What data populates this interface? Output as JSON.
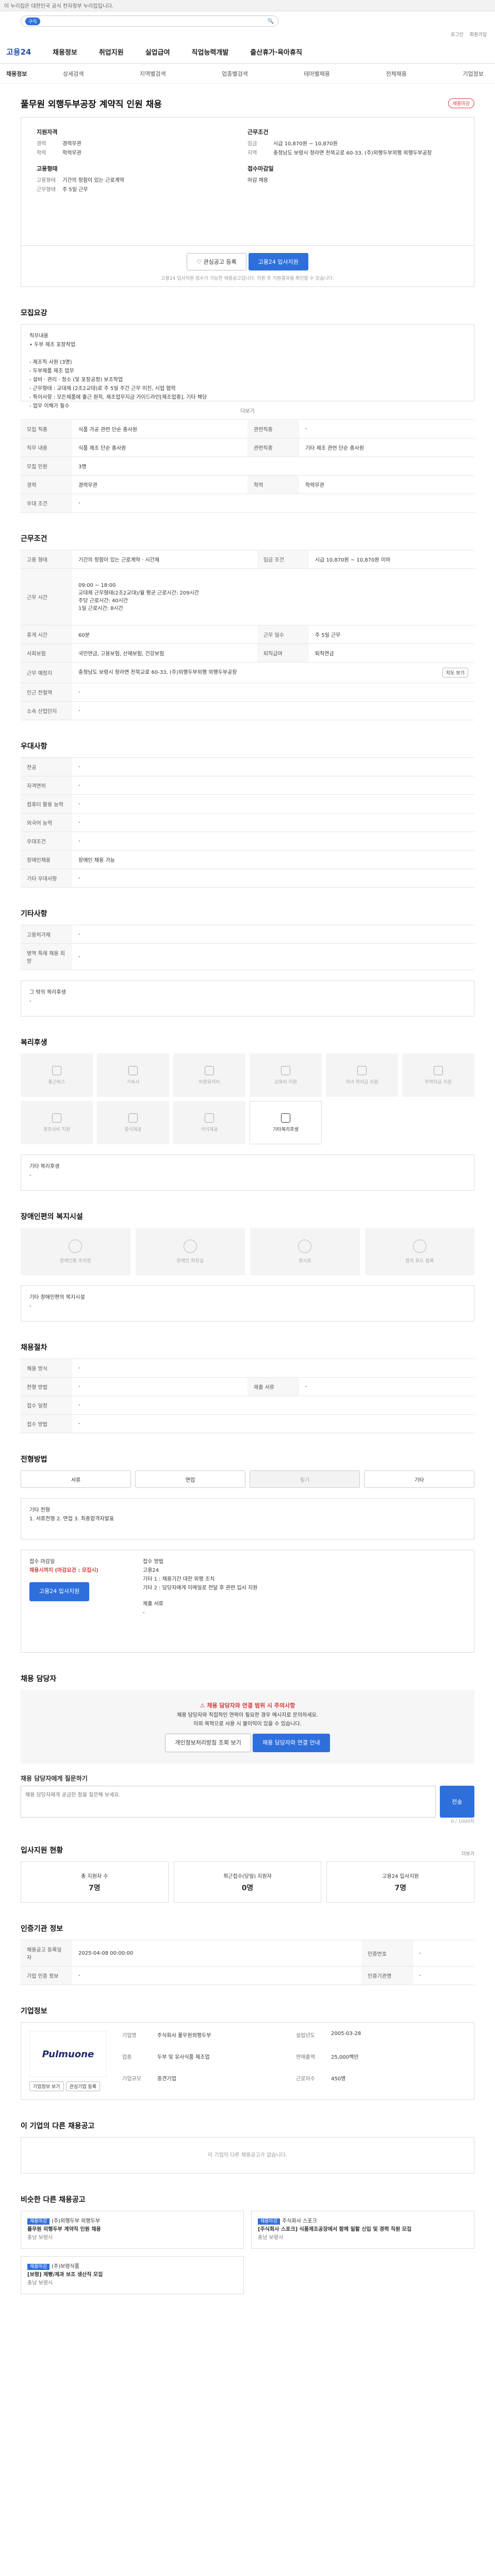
{
  "topbar": {
    "notice": "이 누리집은 대한민국 공식 전자정부 누리집입니다."
  },
  "search": {
    "tag": "구직",
    "placeholder": ""
  },
  "util": [
    "로그인",
    "회원가입"
  ],
  "gnb": {
    "logo": "고용24",
    "menu": [
      "채용정보",
      "취업지원",
      "실업급여",
      "직업능력개발",
      "출산휴가·육아휴직"
    ]
  },
  "subnav": {
    "current": "채용정보",
    "items": [
      "상세검색",
      "지역별검색",
      "업종별검색",
      "테마별채용",
      "전체채용",
      "기업정보"
    ]
  },
  "job": {
    "title": "풀무원 외행두부공장 계약직 인원 채용",
    "badge": "채용마감",
    "recruit_head": "지원자격",
    "recruit": [
      {
        "k": "경력",
        "v": "경력무관"
      },
      {
        "k": "학력",
        "v": "학력무관"
      }
    ],
    "cond_head": "근무조건",
    "cond": [
      {
        "k": "임금",
        "v": "시급 10,870원 ~ 10,870원"
      },
      {
        "k": "지역",
        "v": "충청남도 보령시 청라면 천북교로 60-33, (주)외행두부외행 외행두부공장"
      }
    ],
    "emp_head": "고용형태",
    "emp": [
      {
        "k": "고용형태",
        "v": "기간의 정함이 있는 근로계약"
      },
      {
        "k": "근무형태",
        "v": "주 5일 근무"
      }
    ],
    "deadline_head": "접수마감일",
    "deadline": "마감 채용",
    "btn_scrap": "관심공고 등록",
    "btn_apply": "고용24 입사지원",
    "apply_note": "고용24 입사지원 접수가 가능한 채용공고입니다. 지원 후 지원결과를 확인할 수 있습니다."
  },
  "sec1": {
    "title": "모집요강",
    "body": "직무내용\n• 두부 제조 포장작업\n\n- 제조직 사원 (3명)\n- 두부제품 제조 업무\n- 설비 · 관리 · 청소 (및 포장공정) 보조작업\n- 근무형태 : 교대제 (2조2교대)로 주 5일 주간 근무 미진, 시업 협력\n- 특이사항 : 모든제품에 출근 원칙, 제조업무지금 가이드라인[제조업종], 기타 해당\n- 업무 이해가 필수",
    "more": "더보기",
    "rows": [
      {
        "k": "모집 직종",
        "v": "식품 가공 관련 단순 종사원",
        "k2": "관련직종",
        "v2": "-"
      },
      {
        "k": "직무 내용",
        "v": "식품 제조 단순 종사원",
        "k2": "관련직종",
        "v2": "기타 제조 관련 단순 종사원"
      },
      {
        "k": "모집 인원",
        "v": "3명",
        "k2": "",
        "v2": ""
      },
      {
        "k": "경력",
        "v": "경력무관",
        "k2": "학력",
        "v2": "학력무관"
      },
      {
        "k": "우대 조건",
        "v": "-",
        "k2": "",
        "v2": ""
      }
    ]
  },
  "sec2": {
    "title": "근무조건",
    "rows": [
      {
        "k": "고용 형태",
        "v": "기간의 정함이 있는 근로계약 · 시간제",
        "k2": "임금 조건",
        "v2": "시급 10,870원 ~ 10,870원 이하"
      },
      {
        "k": "근무 시간",
        "v": "09:00 ~ 18:00\n교대제 근무형태(2조2교대)/월 평균 근로시간: 209시간\n주당 근로시간: 40시간\n1일 근로시간: 8시간",
        "k2": "",
        "v2": ""
      },
      {
        "k": "휴게 시간",
        "v": "60분",
        "k2": "근무 일수",
        "v2": "주 5일 근무"
      },
      {
        "k": "사회보험",
        "v": "국민연금, 고용보험, 산재보험, 건강보험",
        "k2": "퇴직급여",
        "v2": "퇴직연금"
      },
      {
        "k": "근무 예정지",
        "v": "충청남도 보령시 청라면 천북교로 60-33, (주)외행두부외행 외행두부공장",
        "k2": "",
        "v2": ""
      },
      {
        "k": "인근 전철역",
        "v": "-",
        "k2": "",
        "v2": ""
      },
      {
        "k": "소속 산업단지",
        "v": "-",
        "k2": "",
        "v2": ""
      }
    ],
    "map_btn": "지도 보기"
  },
  "sec3": {
    "title": "우대사항",
    "rows": [
      {
        "k": "전공",
        "v": "-"
      },
      {
        "k": "자격면허",
        "v": "-"
      },
      {
        "k": "컴퓨터 활용 능력",
        "v": "-"
      },
      {
        "k": "외국어 능력",
        "v": "-"
      },
      {
        "k": "우대조건",
        "v": "-"
      },
      {
        "k": "장애인채용",
        "v": "장애인 채용 가능"
      },
      {
        "k": "기타 우대사항",
        "v": "-"
      }
    ]
  },
  "sec4": {
    "title": "기타사항",
    "rows": [
      {
        "k": "고용허가제",
        "v": "-"
      },
      {
        "k": "병역 특례 채용 희망",
        "v": "-"
      }
    ],
    "other_head": "그 밖의 복리후생",
    "other": "-"
  },
  "sec5": {
    "title": "복리후생",
    "items": [
      "통근버스",
      "기숙사",
      "차량유지비",
      "교육비 지원",
      "자녀 학자금 지원",
      "주택자금 지원",
      "경조사비 지원",
      "중식제공",
      "석식제공",
      "기타복리후생"
    ],
    "other_head": "기타 복리후생",
    "other": "-"
  },
  "sec6": {
    "title": "장애인편의 복지시설",
    "items": [
      "장애인용 주차장",
      "장애인 화장실",
      "경사로",
      "점자 유도 블록"
    ],
    "other_head": "기타 장애인편의 복지시설",
    "other": "-"
  },
  "sec7": {
    "title": "채용절차",
    "rows": [
      {
        "k": "채용 방식",
        "v": "-",
        "k2": "",
        "v2": ""
      },
      {
        "k": "전형 방법",
        "v": "-",
        "k2": "제출 서류",
        "v2": "-"
      },
      {
        "k": "접수 일정",
        "v": "-",
        "k2": "",
        "v2": ""
      },
      {
        "k": "접수 방법",
        "v": "-",
        "k2": "",
        "v2": ""
      }
    ]
  },
  "sec8": {
    "title": "전형방법",
    "seg": [
      "서류",
      "면접",
      "필기",
      "기타"
    ],
    "etc_head": "기타 전형",
    "etc": "1. 서류전형  2. 면접  3. 최종합격자발표",
    "apply_head": "접수 마감일",
    "apply_val": "채용시까지 (마감요건 : 모집시)",
    "apply_btn": "고용24 입사지원",
    "method_head": "접수 방법",
    "method": "고용24\n기타 1 : 채용기간 대한 외행 조치\n기타 2 : 담당자에게 이메일로 전달 후 관련 입사 지원",
    "docs_head": "제출 서류",
    "docs": "-"
  },
  "sec9": {
    "title": "채용 담당자",
    "alert_head": "채용 담당자와 연결 범위 시 주의사항",
    "alert": "채용 담당자와 직접적인 연락이 필요한 경우 메시지로 문의하세요.\n이외 목적으로 사용 시 불이익이 있을 수 있습니다.",
    "btn1": "개인정보처리방침 조회 보기",
    "btn2": "채용 담당자와 연결 안내",
    "ask_head": "채용 담당자에게 질문하기",
    "ask_ph": "채용 담당자에게 궁금한 점을 질문해 보세요.",
    "ask_btn": "전송",
    "count": "0 / 1000자"
  },
  "sec10": {
    "title": "입사지원 현황",
    "more": "더보기",
    "stats": [
      {
        "k": "총 지원자 수",
        "v": "7명"
      },
      {
        "k": "최근접수(당일) 지원자",
        "v": "0명"
      },
      {
        "k": "고용24 입사지원",
        "v": "7명"
      }
    ]
  },
  "sec11": {
    "title": "인증기관 정보",
    "rows": [
      {
        "k": "채용공고 등록일자",
        "v": "2025-04-08 00:00:00",
        "k2": "인증번호",
        "v2": "-"
      },
      {
        "k": "기업 인증 정보",
        "v": "-",
        "k2": "인증기관명",
        "v2": "-"
      }
    ]
  },
  "sec12": {
    "title": "기업정보",
    "logo": "Pulmuone",
    "rows": [
      {
        "k": "기업명",
        "v": "주식회사 풀무원외행두부"
      },
      {
        "k": "업종",
        "v": "두부 및 유사식품 제조업"
      },
      {
        "k": "기업규모",
        "v": "중견기업"
      },
      {
        "k": "설립년도",
        "v": "2005-03-28"
      },
      {
        "k": "연매출액",
        "v": "25,000백만"
      },
      {
        "k": "근로자수",
        "v": "450명"
      }
    ],
    "btn_view": "기업정보 보기",
    "btn_fav": "관심기업 등록"
  },
  "sec13": {
    "title": "이 기업의 다른 채용공고",
    "empty": "이 기업의 다른 채용공고가 없습니다."
  },
  "sec14": {
    "title": "비슷한 다른 채용공고",
    "cards": [
      {
        "tag": "채용마감",
        "title": "풀무원 외행두부 계약직 인원 채용",
        "sub": "(주)외행두부 외행두부",
        "loc": "충남 보령시"
      },
      {
        "tag": "채용마감",
        "title": "[주식회사 스포크] 식품제조공장에서 함께 일할 신입 및 경력 직원 모집",
        "sub": "주식회사 스포크",
        "loc": "충남 보령시"
      },
      {
        "tag": "채용마감",
        "title": "[보령] 제빵/제과 보조 생산직 모집",
        "sub": "(주)보령식품",
        "loc": "충남 보령시"
      }
    ]
  }
}
